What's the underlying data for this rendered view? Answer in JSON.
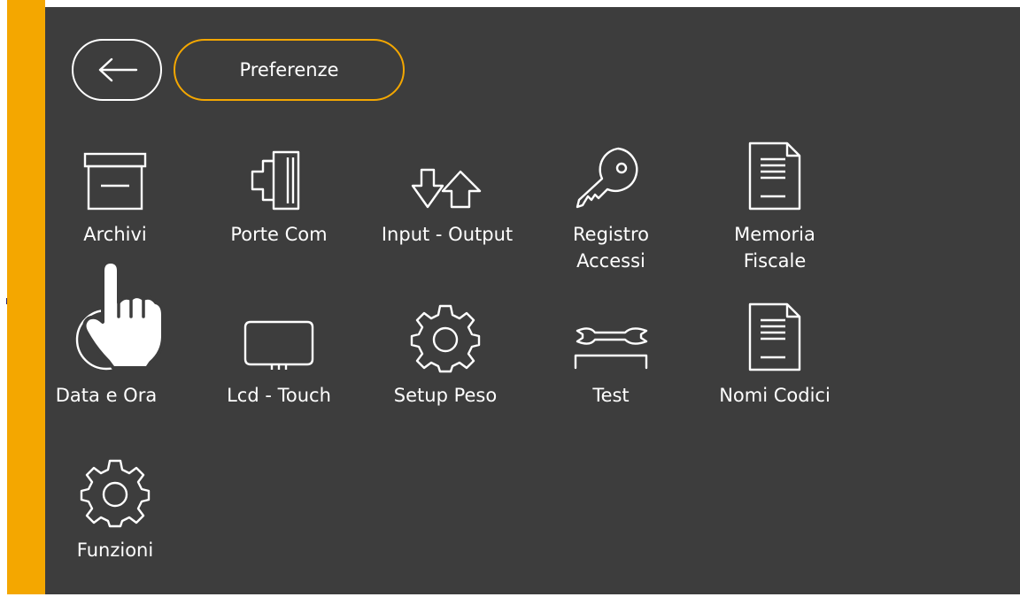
{
  "header": {
    "back_icon": "arrow-left-icon",
    "title": "Preferenze"
  },
  "theme": {
    "accent": "#f4a700",
    "panel": "#3d3d3d",
    "foreground": "#ffffff"
  },
  "menu": {
    "items": [
      {
        "label": "Archivi",
        "icon": "archive-box-icon"
      },
      {
        "label": "Porte Com",
        "icon": "serial-port-icon"
      },
      {
        "label": "Input - Output",
        "icon": "transfer-arrows-icon"
      },
      {
        "label": "Registro\nAccessi",
        "icon": "key-icon"
      },
      {
        "label": "Memoria\nFiscale",
        "icon": "document-icon"
      },
      {
        "label": "Data e Ora",
        "icon": "clock-icon"
      },
      {
        "label": "Lcd - Touch",
        "icon": "lcd-display-icon"
      },
      {
        "label": "Setup Peso",
        "icon": "gear-icon"
      },
      {
        "label": "Test",
        "icon": "wrench-icon"
      },
      {
        "label": "Nomi Codici",
        "icon": "document-icon"
      },
      {
        "label": "Funzioni",
        "icon": "gear-icon"
      }
    ]
  },
  "overlay": {
    "pointer_icon": "hand-pointer-icon"
  }
}
